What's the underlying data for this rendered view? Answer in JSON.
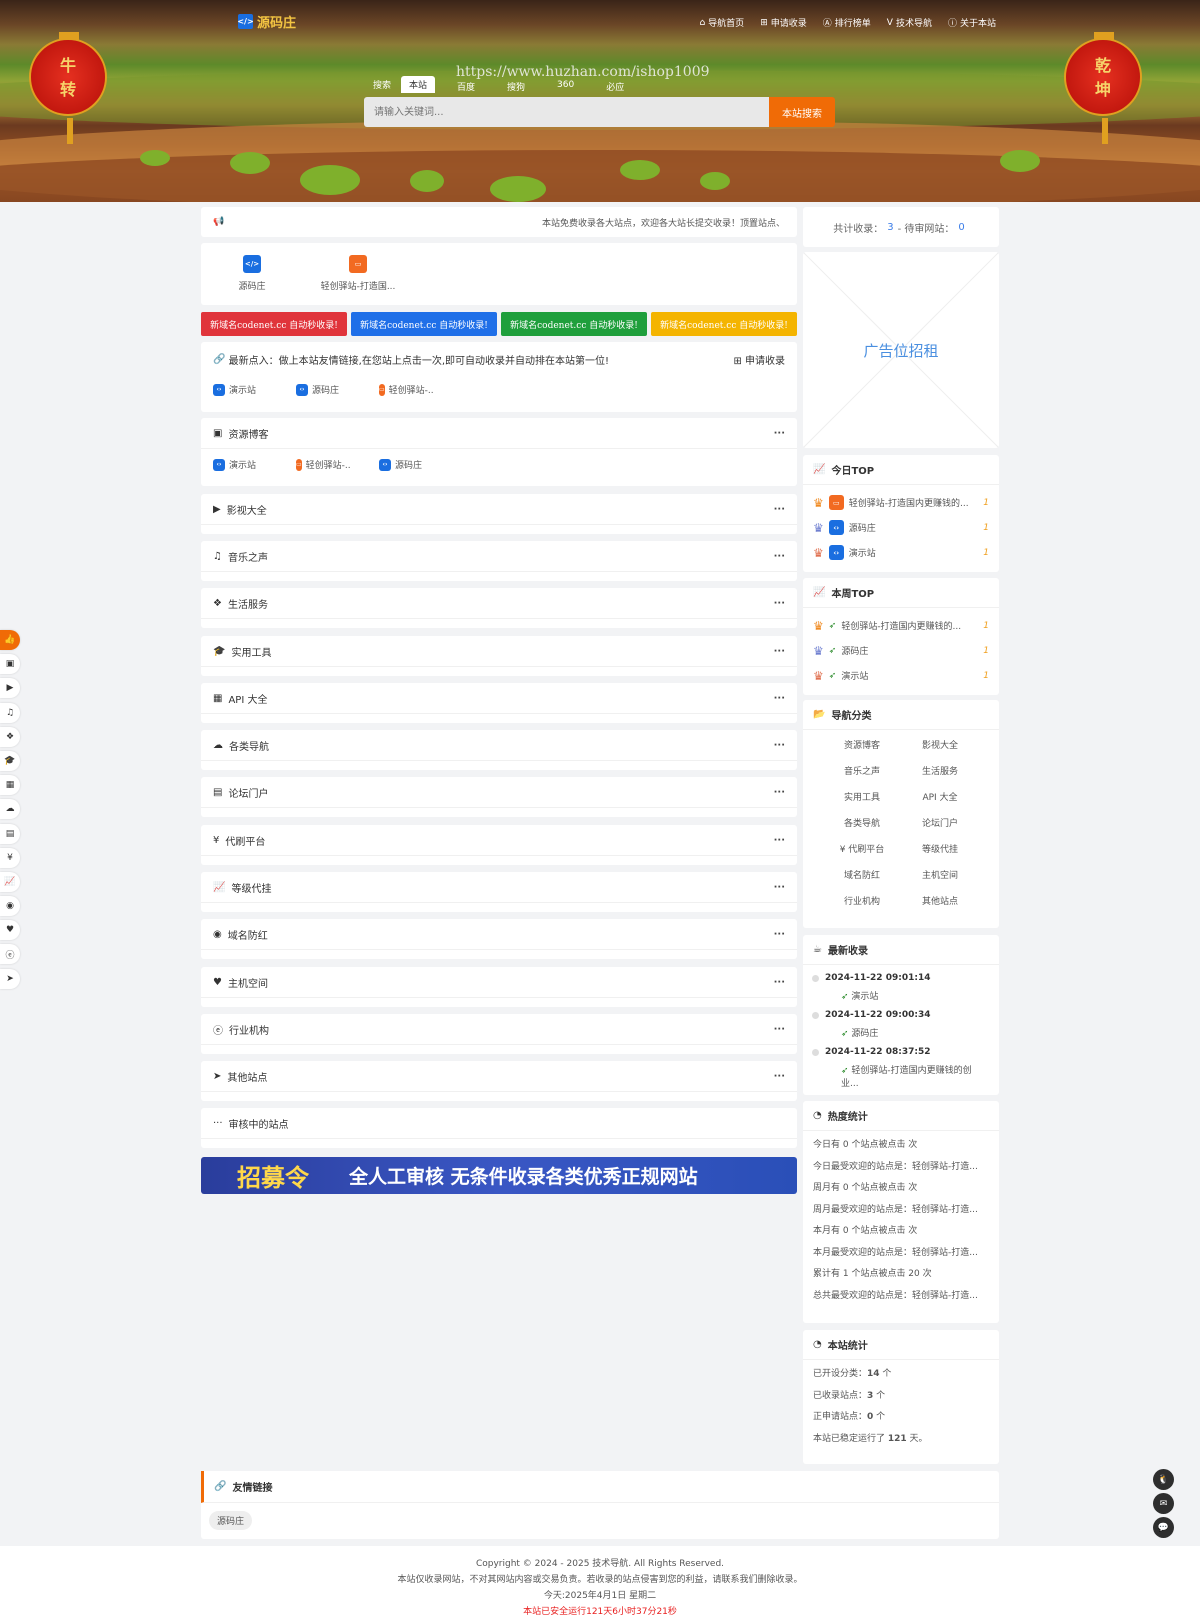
{
  "header": {
    "logo_text": "源码庄",
    "nav": [
      {
        "icon": "home-icon",
        "label": "导航首页"
      },
      {
        "icon": "plus-square-icon",
        "label": "申请收录"
      },
      {
        "icon": "ranking-icon",
        "label": "排行榜单"
      },
      {
        "icon": "v-icon",
        "label": "技术导航"
      },
      {
        "icon": "info-icon",
        "label": "关于本站"
      }
    ],
    "lantern_left": [
      "牛",
      "转"
    ],
    "lantern_right": [
      "乾",
      "坤"
    ],
    "watermark": "https://www.huzhan.com/ishop1009",
    "search_tabs": [
      "搜索",
      "本站"
    ],
    "engines": [
      "百度",
      "搜狗",
      "360",
      "必应"
    ],
    "search_placeholder": "请输入关键词...",
    "search_button": "本站搜索"
  },
  "notice": {
    "text": "本站免费收录各大站点，欢迎各大站长提交收录！顶置站点、"
  },
  "featured": [
    {
      "name": "源码庄",
      "color": "blue"
    },
    {
      "name": "轻创驿站-打造国...",
      "color": "orange"
    }
  ],
  "promo_buttons": [
    {
      "label": "新域名codenet.cc 自动秒收录!",
      "color": "#e0343b"
    },
    {
      "label": "新域名codenet.cc 自动秒收录!",
      "color": "#1f6fe8"
    },
    {
      "label": "新域名codenet.cc 自动秒收录!",
      "color": "#1f9f3c"
    },
    {
      "label": "新域名codenet.cc 自动秒收录!",
      "color": "#f4b400"
    }
  ],
  "latest": {
    "title": "最新点入：做上本站友情链接,在您站上点击一次,即可自动收录并自动排在本站第一位!",
    "apply": "申请收录",
    "items": [
      "演示站",
      "源码庄",
      "轻创驿站-..."
    ]
  },
  "resource_blog": {
    "title": "资源博客",
    "more": "···",
    "items": [
      "演示站",
      "轻创驿站-...",
      "源码庄"
    ]
  },
  "sections": [
    {
      "icon": "youtube-icon",
      "title": "影视大全"
    },
    {
      "icon": "music-icon",
      "title": "音乐之声"
    },
    {
      "icon": "cubes-icon",
      "title": "生活服务"
    },
    {
      "icon": "graduation-icon",
      "title": "实用工具"
    },
    {
      "icon": "grid-icon",
      "title": "API 大全"
    },
    {
      "icon": "cloud-icon",
      "title": "各类导航"
    },
    {
      "icon": "file-icon",
      "title": "论坛门户"
    },
    {
      "icon": "yen-icon",
      "title": "代刷平台"
    },
    {
      "icon": "chart-icon",
      "title": "等级代挂"
    },
    {
      "icon": "compass-icon",
      "title": "域名防红"
    },
    {
      "icon": "heartbeat-icon",
      "title": "主机空间"
    },
    {
      "icon": "edge-icon",
      "title": "行业机构"
    },
    {
      "icon": "send-icon",
      "title": "其他站点"
    }
  ],
  "pending": {
    "title": "审核中的站点"
  },
  "banner": {
    "left": "招募令",
    "right": "全人工审核  无条件收录各类优秀正规网站"
  },
  "side_stat": {
    "label1": "共计收录：",
    "count1": "3",
    "label2": "- 待审网站：",
    "count2": "0"
  },
  "ad": {
    "text": "广告位招租"
  },
  "today_top": {
    "title": "今日TOP",
    "items": [
      {
        "name": "轻创驿站-打造国内更赚钱的...",
        "count": "1",
        "fav": "orange"
      },
      {
        "name": "源码庄",
        "count": "1",
        "fav": "blue"
      },
      {
        "name": "演示站",
        "count": "1",
        "fav": "blue"
      }
    ]
  },
  "week_top": {
    "title": "本周TOP",
    "items": [
      {
        "name": "轻创驿站-打造国内更赚钱的...",
        "count": "1"
      },
      {
        "name": "源码庄",
        "count": "1"
      },
      {
        "name": "演示站",
        "count": "1"
      }
    ]
  },
  "nav_categories": {
    "title": "导航分类",
    "items": [
      "资源博客",
      "影视大全",
      "音乐之声",
      "生活服务",
      "实用工具",
      "API 大全",
      "各类导航",
      "论坛门户",
      "¥ 代刷平台",
      "等级代挂",
      "域名防红",
      "主机空间",
      "行业机构",
      "其他站点"
    ]
  },
  "newest": {
    "title": "最新收录",
    "items": [
      {
        "time": "2024-11-22 09:01:14",
        "name": "演示站"
      },
      {
        "time": "2024-11-22 09:00:34",
        "name": "源码庄"
      },
      {
        "time": "2024-11-22 08:37:52",
        "name": "轻创驿站-打造国内更赚钱的创业..."
      }
    ]
  },
  "hot_stats": {
    "title": "热度统计",
    "lines": [
      "今日有 0 个站点被点击 次",
      "今日最受欢迎的站点是：轻创驿站-打造...",
      "周月有 0 个站点被点击 次",
      "周月最受欢迎的站点是：轻创驿站-打造...",
      "本月有 0 个站点被点击 次",
      "本月最受欢迎的站点是：轻创驿站-打造...",
      "累计有 1 个站点被点击 20 次",
      "总共最受欢迎的站点是：轻创驿站-打造..."
    ]
  },
  "site_stats": {
    "title": "本站统计",
    "lines": [
      {
        "label": "已开设分类：",
        "value": "14",
        "unit": " 个"
      },
      {
        "label": "已收录站点：",
        "value": "3",
        "unit": " 个"
      },
      {
        "label": "正申请站点：",
        "value": "0",
        "unit": " 个"
      },
      {
        "label": "本站已稳定运行了 ",
        "value": "121",
        "unit": " 天。"
      }
    ]
  },
  "friends": {
    "title": "友情链接",
    "items": [
      "源码庄"
    ]
  },
  "footer": {
    "copyright": "Copyright © 2024 - 2025 技术导航. All Rights Reserved.",
    "disclaimer": "本站仅收录网站，不对其网站内容或交易负责。若收录的站点侵害到您的利益，请联系我们删除收录。",
    "date": "今天:2025年4月1日 星期二",
    "runtime": "本站已安全运行121天6小时37分21秒"
  },
  "colors": {
    "accent": "#f06b06",
    "link_blue": "#3b7de8"
  }
}
